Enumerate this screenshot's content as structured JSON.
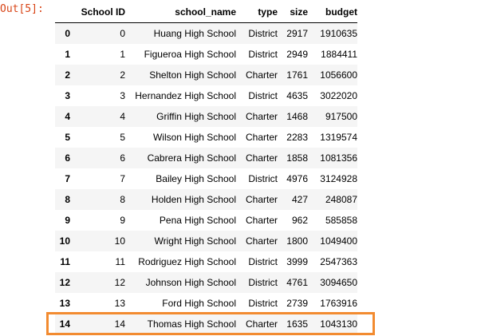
{
  "prompt": "Out[5]:",
  "table": {
    "columns": [
      "",
      "School ID",
      "school_name",
      "type",
      "size",
      "budget"
    ],
    "rows": [
      [
        "0",
        "0",
        "Huang High School",
        "District",
        "2917",
        "1910635"
      ],
      [
        "1",
        "1",
        "Figueroa High School",
        "District",
        "2949",
        "1884411"
      ],
      [
        "2",
        "2",
        "Shelton High School",
        "Charter",
        "1761",
        "1056600"
      ],
      [
        "3",
        "3",
        "Hernandez High School",
        "District",
        "4635",
        "3022020"
      ],
      [
        "4",
        "4",
        "Griffin High School",
        "Charter",
        "1468",
        "917500"
      ],
      [
        "5",
        "5",
        "Wilson High School",
        "Charter",
        "2283",
        "1319574"
      ],
      [
        "6",
        "6",
        "Cabrera High School",
        "Charter",
        "1858",
        "1081356"
      ],
      [
        "7",
        "7",
        "Bailey High School",
        "District",
        "4976",
        "3124928"
      ],
      [
        "8",
        "8",
        "Holden High School",
        "Charter",
        "427",
        "248087"
      ],
      [
        "9",
        "9",
        "Pena High School",
        "Charter",
        "962",
        "585858"
      ],
      [
        "10",
        "10",
        "Wright High School",
        "Charter",
        "1800",
        "1049400"
      ],
      [
        "11",
        "11",
        "Rodriguez High School",
        "District",
        "3999",
        "2547363"
      ],
      [
        "12",
        "12",
        "Johnson High School",
        "District",
        "4761",
        "3094650"
      ],
      [
        "13",
        "13",
        "Ford High School",
        "District",
        "2739",
        "1763916"
      ],
      [
        "14",
        "14",
        "Thomas High School",
        "Charter",
        "1635",
        "1043130"
      ]
    ]
  },
  "highlight": {
    "row_index": 14,
    "color": "#f28b30"
  }
}
